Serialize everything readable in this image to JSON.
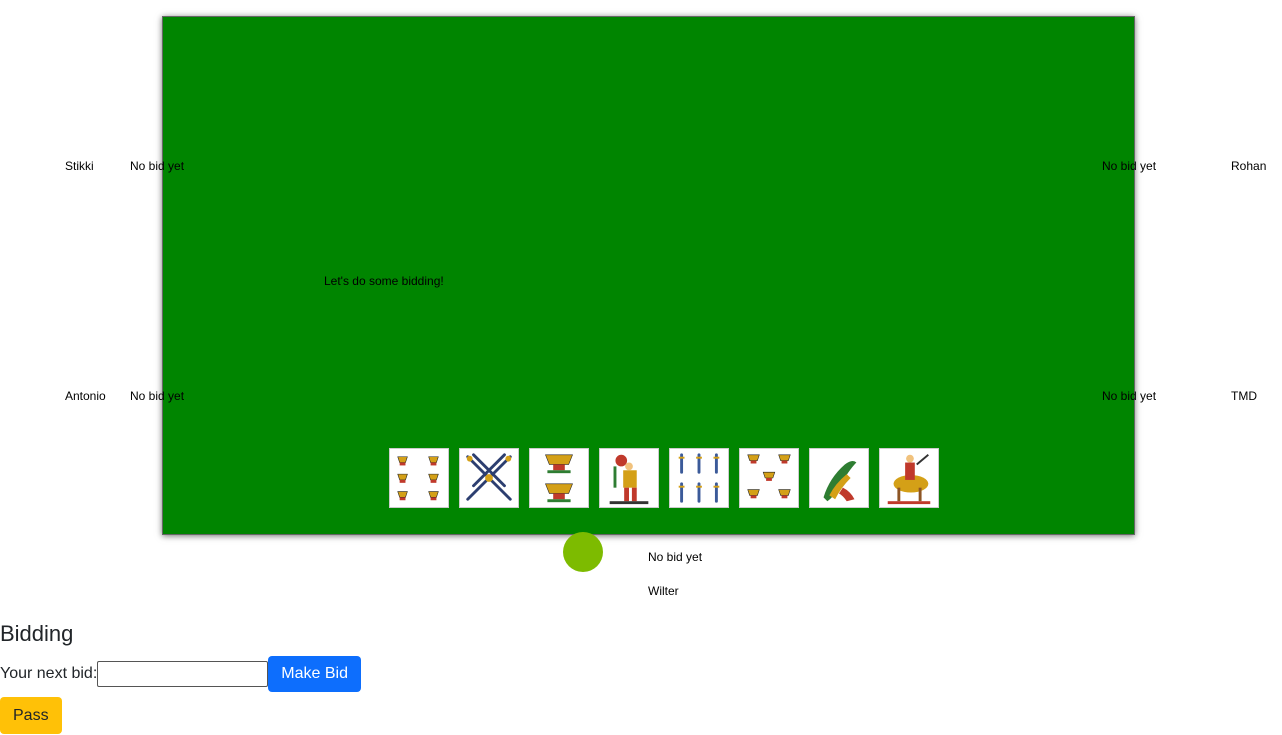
{
  "players": {
    "top_left": {
      "name": "Stikki",
      "bid": "No bid yet"
    },
    "mid_left": {
      "name": "Antonio",
      "bid": "No bid yet"
    },
    "top_right": {
      "name": "Rohan",
      "bid": "No bid yet"
    },
    "mid_right": {
      "name": "TMD",
      "bid": "No bid yet"
    },
    "self": {
      "name": "Wilter",
      "bid": "No bid yet"
    }
  },
  "table": {
    "message": "Let's do some bidding!"
  },
  "hand": [
    {
      "name": "cups-six-card"
    },
    {
      "name": "swords-four-card"
    },
    {
      "name": "cups-two-card"
    },
    {
      "name": "jack-card"
    },
    {
      "name": "swords-six-card"
    },
    {
      "name": "cups-five-card"
    },
    {
      "name": "clubs-ace-card"
    },
    {
      "name": "king-card"
    }
  ],
  "colors": {
    "table": "#008500",
    "dealer_chip": "#7dbb00",
    "primary": "#0d6efd",
    "warning": "#ffc107"
  },
  "bidding": {
    "title": "Bidding",
    "label": "Your next bid:",
    "input_value": "",
    "make_bid_label": "Make Bid",
    "pass_label": "Pass"
  }
}
